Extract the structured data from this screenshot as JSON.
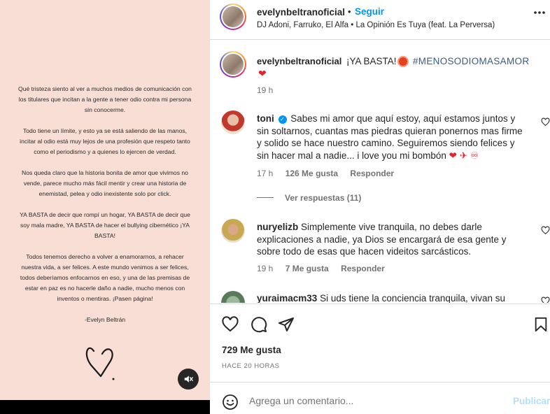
{
  "media": {
    "paragraphs": [
      "Qué tristeza siento al ver a muchos medios de comunicación con los titulares que incitan a la gente a tener odio contra mi persona sin conocerme.",
      "Todo tiene un límite, y esto ya se está saliendo de las manos, incitar al odio está muy lejos de una profesión que respeto tanto como el periodismo y a quienes lo ejercen de verdad.",
      "Nos queda claro que la historia bonita de amor que vivimos no vende, parece mucho más fácil mentir y crear una historia de enemistad, pelea y odio inexistente solo por click.",
      "YA BASTA de decir que rompí un hogar, YA BASTA de decir que soy mala madre, YA BASTA de hacer el bullying cibernético ¡YA BASTA!",
      "Todos tenemos derecho a volver a enamorarnos, a rehacer nuestra vida, a ser felices. A este mundo venimos a ser felices, todos deberíamos enfocarnos en eso, y una de las premisas de estar en paz es no hacerle daño a nadie, mucho menos con inventos o mentiras. ¡Pasen página!"
    ],
    "signature": "-Evelyn Beltrán",
    "mute_icon": "speaker-muted-icon"
  },
  "header": {
    "username": "evelynbeltranoficial",
    "dot": "•",
    "follow_label": "Seguir",
    "audio": "DJ Adoni, Farruko, El Alfa • La Opinión Es Tuya (feat. La Perversa)"
  },
  "caption": {
    "username": "evelynbeltranoficial",
    "text": "¡YA BASTA!",
    "hashtag": "#MENOSODIOMASAMOR",
    "heart": "❤",
    "time": "19 h"
  },
  "comments": [
    {
      "username": "toni",
      "text": "Sabes mi amor que aquí estoy, aquí estamos juntos y sin soltarnos, cuantas mas piedras quieran ponernos mas firme y solido se hace nuestro camino. Seguiremos siendo felices y sin hacer mal a nadie... i love you mi bombón",
      "emojis": "❤ ✈ ♾",
      "time": "17 h",
      "likes": "126 Me gusta",
      "reply": "Responder",
      "view_replies": "Ver respuestas (11)"
    },
    {
      "username": "nuryelizb",
      "text": "Simplemente vive tranquila, no debes darle explicaciones a nadie, ya Dios se encargará de esa gente y sobre todo de esas que hacen videitos sarcásticos.",
      "time": "19 h",
      "likes": "7 Me gusta",
      "reply": "Responder"
    },
    {
      "username": "yuraimacm33",
      "text": "Si uds tiene la conciencia tranquila, vivan su"
    }
  ],
  "footer": {
    "likes": "729 Me gusta",
    "time": "HACE 20 HORAS",
    "comment_placeholder": "Agrega un comentario...",
    "publish_label": "Publicar"
  },
  "colors": {
    "accent": "#0095f6",
    "media_bg": "#f8ded4",
    "hashtag": "#3a5a86",
    "heart": "#e02430"
  }
}
